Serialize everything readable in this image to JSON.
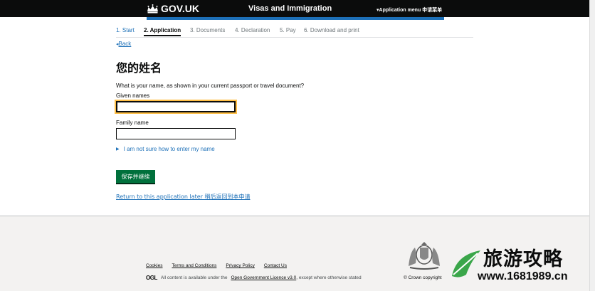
{
  "header": {
    "logo": "GOV.UK",
    "service_name": "Visas and Immigration",
    "menu": "▾Application menu 申请菜单"
  },
  "steps": [
    {
      "label": "1. Start",
      "state": "done"
    },
    {
      "label": "2. Application",
      "state": "current"
    },
    {
      "label": "3. Documents",
      "state": "todo"
    },
    {
      "label": "4. Declaration",
      "state": "todo"
    },
    {
      "label": "5. Pay",
      "state": "todo"
    },
    {
      "label": "6. Download and print",
      "state": "todo"
    }
  ],
  "back": {
    "arrow": "◂",
    "label": "Back"
  },
  "page_title": "您的姓名",
  "question": "What is your name, as shown in your current passport or travel document?",
  "fields": {
    "given_label": "Given names",
    "given_value": "",
    "family_label": "Family name",
    "family_value": ""
  },
  "details": {
    "arrow": "▶",
    "label": "I am not sure how to enter my name"
  },
  "submit_label": "保存并继续",
  "return_link": "Return to this application later 稍后返回到本申请",
  "footer": {
    "links": [
      "Cookies",
      "Terms and Conditions",
      "Privacy Policy",
      "Contact Us"
    ],
    "ogl": "OGL",
    "licence_prefix": "All content is available under the",
    "licence_link": "Open Government Licence v3.0",
    "licence_suffix": ", except where otherwise stated",
    "copyright": "© Crown copyright"
  },
  "watermark": {
    "line1": "旅游攻略",
    "line2": "www.1681989.cn"
  },
  "colors": {
    "header": "#0b0c0c",
    "link": "#1d70b8",
    "button": "#00703c",
    "focus": "#ffbf47",
    "footer": "#f3f2f1"
  }
}
